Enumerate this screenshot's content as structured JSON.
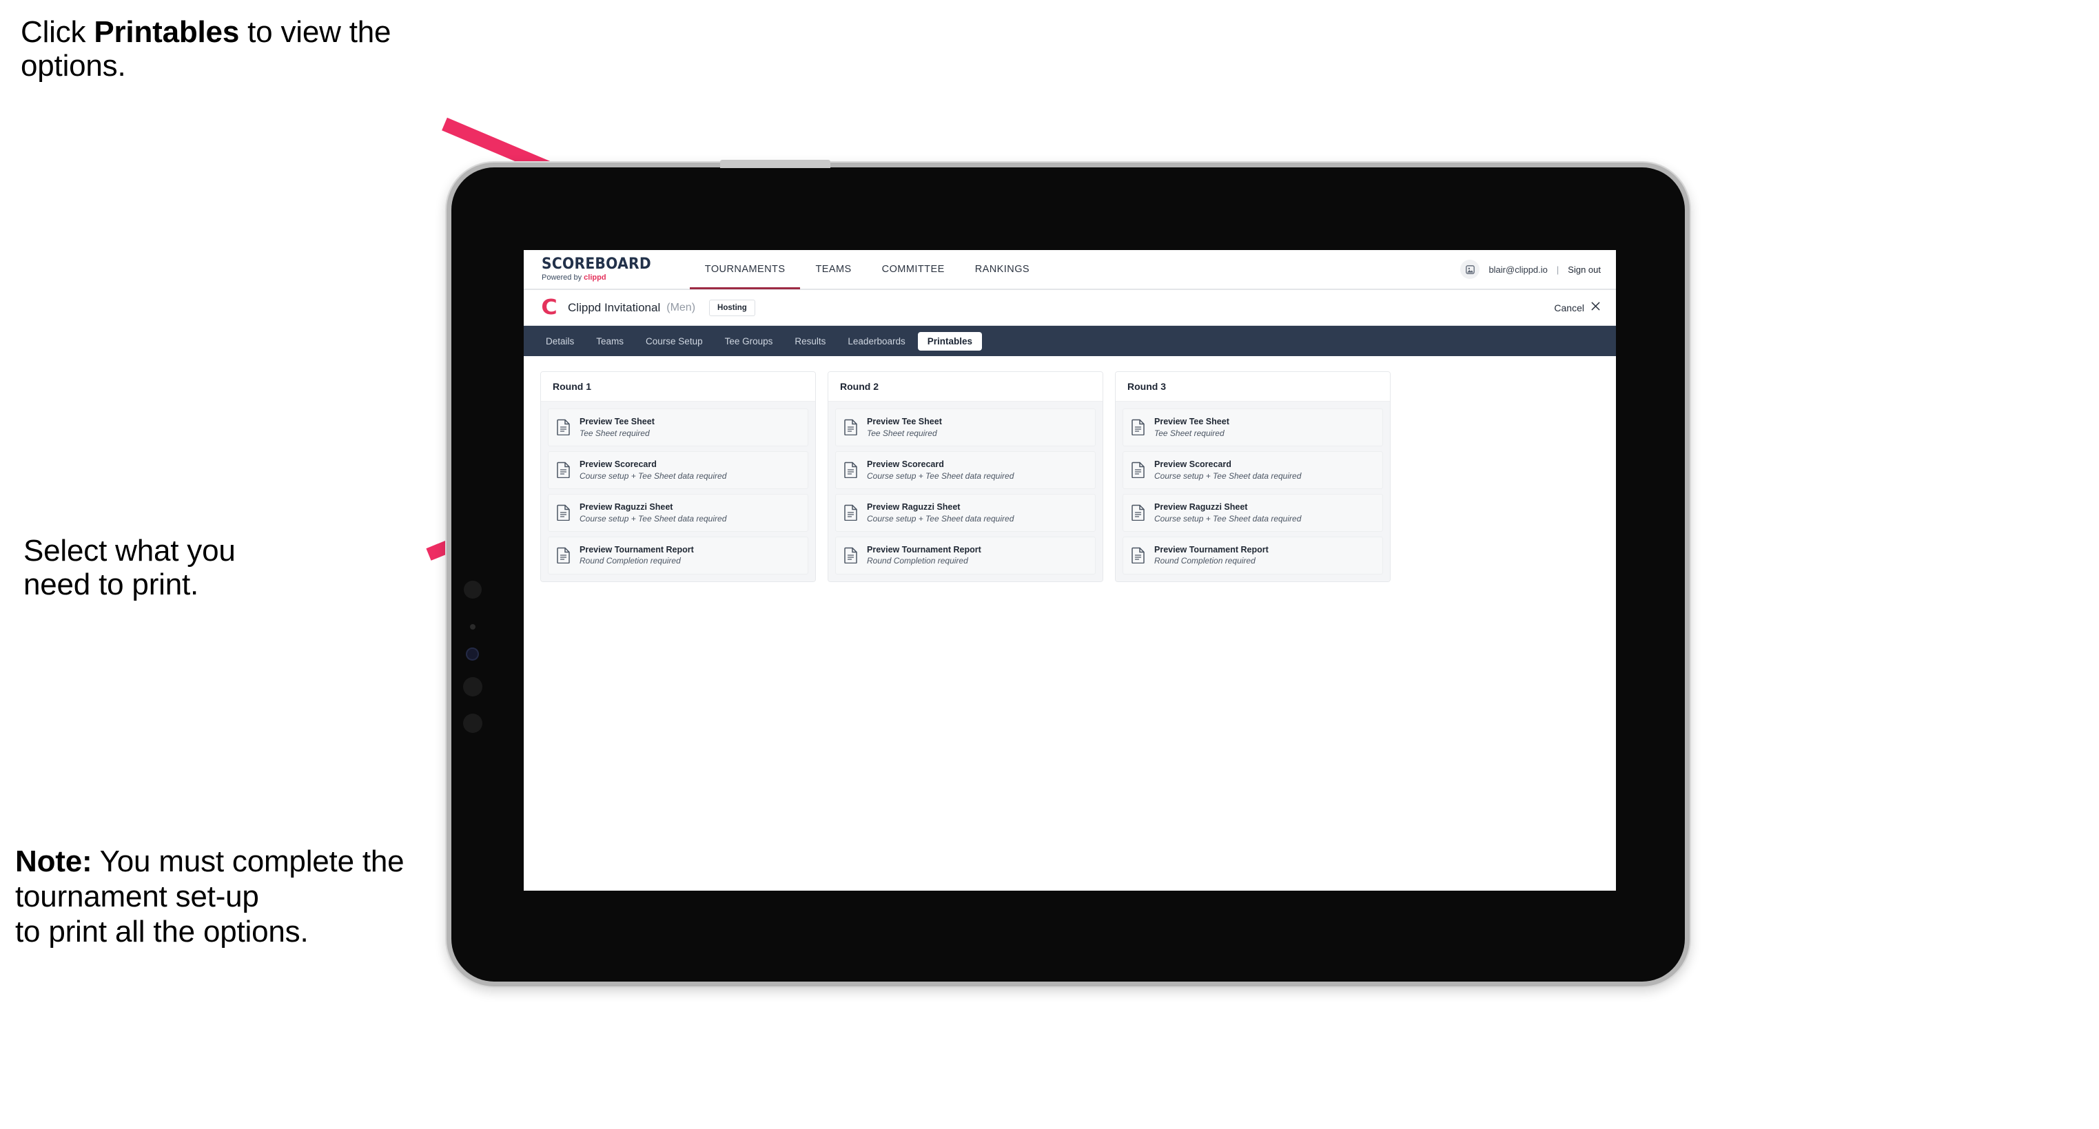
{
  "annotations": {
    "callout_1": {
      "prefix": "Click ",
      "bold": "Printables",
      "suffix": " to view the options."
    },
    "callout_2": {
      "text": "Select what you\n need to print."
    },
    "callout_3": {
      "bold": "Note:",
      "text": " You must complete the tournament set-up\nto print all the options."
    }
  },
  "browser": {
    "topbar": {
      "brand_title": "SCOREBOARD",
      "brand_sub_prefix": "Powered by ",
      "brand_sub_name": "clippd",
      "nav": [
        {
          "label": "TOURNAMENTS",
          "active": true
        },
        {
          "label": "TEAMS",
          "active": false
        },
        {
          "label": "COMMITTEE",
          "active": false
        },
        {
          "label": "RANKINGS",
          "active": false
        }
      ],
      "avatar_icon": "user-avatar-icon",
      "user_email": "blair@clippd.io",
      "separator": "|",
      "sign_out_label": "Sign out"
    },
    "tournament_header": {
      "logo_letter": "C",
      "name": "Clippd Invitational",
      "gender": "(Men)",
      "status_badge": "Hosting",
      "cancel_label": "Cancel",
      "cancel_icon": "close-x-icon"
    },
    "tabs": [
      {
        "label": "Details",
        "active": false
      },
      {
        "label": "Teams",
        "active": false
      },
      {
        "label": "Course Setup",
        "active": false
      },
      {
        "label": "Tee Groups",
        "active": false
      },
      {
        "label": "Results",
        "active": false
      },
      {
        "label": "Leaderboards",
        "active": false
      },
      {
        "label": "Printables",
        "active": true
      }
    ],
    "rounds": [
      {
        "title": "Round 1",
        "items": [
          {
            "title": "Preview Tee Sheet",
            "sub": "Tee Sheet required"
          },
          {
            "title": "Preview Scorecard",
            "sub": "Course setup + Tee Sheet data required"
          },
          {
            "title": "Preview Raguzzi Sheet",
            "sub": "Course setup + Tee Sheet data required"
          },
          {
            "title": "Preview Tournament Report",
            "sub": "Round Completion required"
          }
        ]
      },
      {
        "title": "Round 2",
        "items": [
          {
            "title": "Preview Tee Sheet",
            "sub": "Tee Sheet required"
          },
          {
            "title": "Preview Scorecard",
            "sub": "Course setup + Tee Sheet data required"
          },
          {
            "title": "Preview Raguzzi Sheet",
            "sub": "Course setup + Tee Sheet data required"
          },
          {
            "title": "Preview Tournament Report",
            "sub": "Round Completion required"
          }
        ]
      },
      {
        "title": "Round 3",
        "items": [
          {
            "title": "Preview Tee Sheet",
            "sub": "Tee Sheet required"
          },
          {
            "title": "Preview Scorecard",
            "sub": "Course setup + Tee Sheet data required"
          },
          {
            "title": "Preview Raguzzi Sheet",
            "sub": "Course setup + Tee Sheet data required"
          },
          {
            "title": "Preview Tournament Report",
            "sub": "Round Completion required"
          }
        ]
      }
    ]
  },
  "colors": {
    "accent_pink": "#ee2d63",
    "brand_navy": "#22314a",
    "tabstrip_navy": "#2e3b50",
    "nav_underline": "#9d2b44",
    "device_body": "#0a0a0a",
    "device_bezel": "#b4b4b4"
  }
}
